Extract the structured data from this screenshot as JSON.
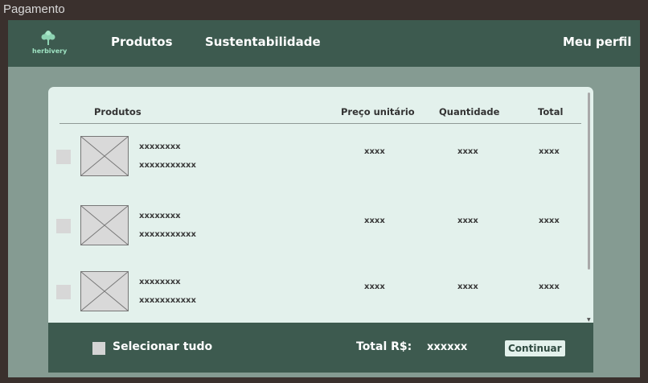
{
  "window": {
    "title": "Pagamento"
  },
  "navbar": {
    "logo_text": "herbivery",
    "logo_icon": "tree-icon",
    "links": [
      "Produtos",
      "Sustentabilidade"
    ],
    "profile": "Meu perfil"
  },
  "table": {
    "headers": {
      "product": "Produtos",
      "unit_price": "Preço unitário",
      "quantity": "Quantidade",
      "total": "Total"
    },
    "rows": [
      {
        "name": "xxxxxxxx",
        "description": "xxxxxxxxxxx",
        "unit_price": "xxxx",
        "quantity": "xxxx",
        "total": "xxxx"
      },
      {
        "name": "xxxxxxxx",
        "description": "xxxxxxxxxxx",
        "unit_price": "xxxx",
        "quantity": "xxxx",
        "total": "xxxx"
      },
      {
        "name": "xxxxxxxx",
        "description": "xxxxxxxxxxx",
        "unit_price": "xxxx",
        "quantity": "xxxx",
        "total": "xxxx"
      }
    ]
  },
  "footer": {
    "select_all": "Selecionar tudo",
    "total_label": "Total R$:",
    "total_value": "xxxxxx",
    "continue": "Continuar"
  },
  "colors": {
    "nav": "#3d5a4f",
    "background": "#859b92",
    "card": "#e3f1ec",
    "accent": "#9ee2c2"
  }
}
